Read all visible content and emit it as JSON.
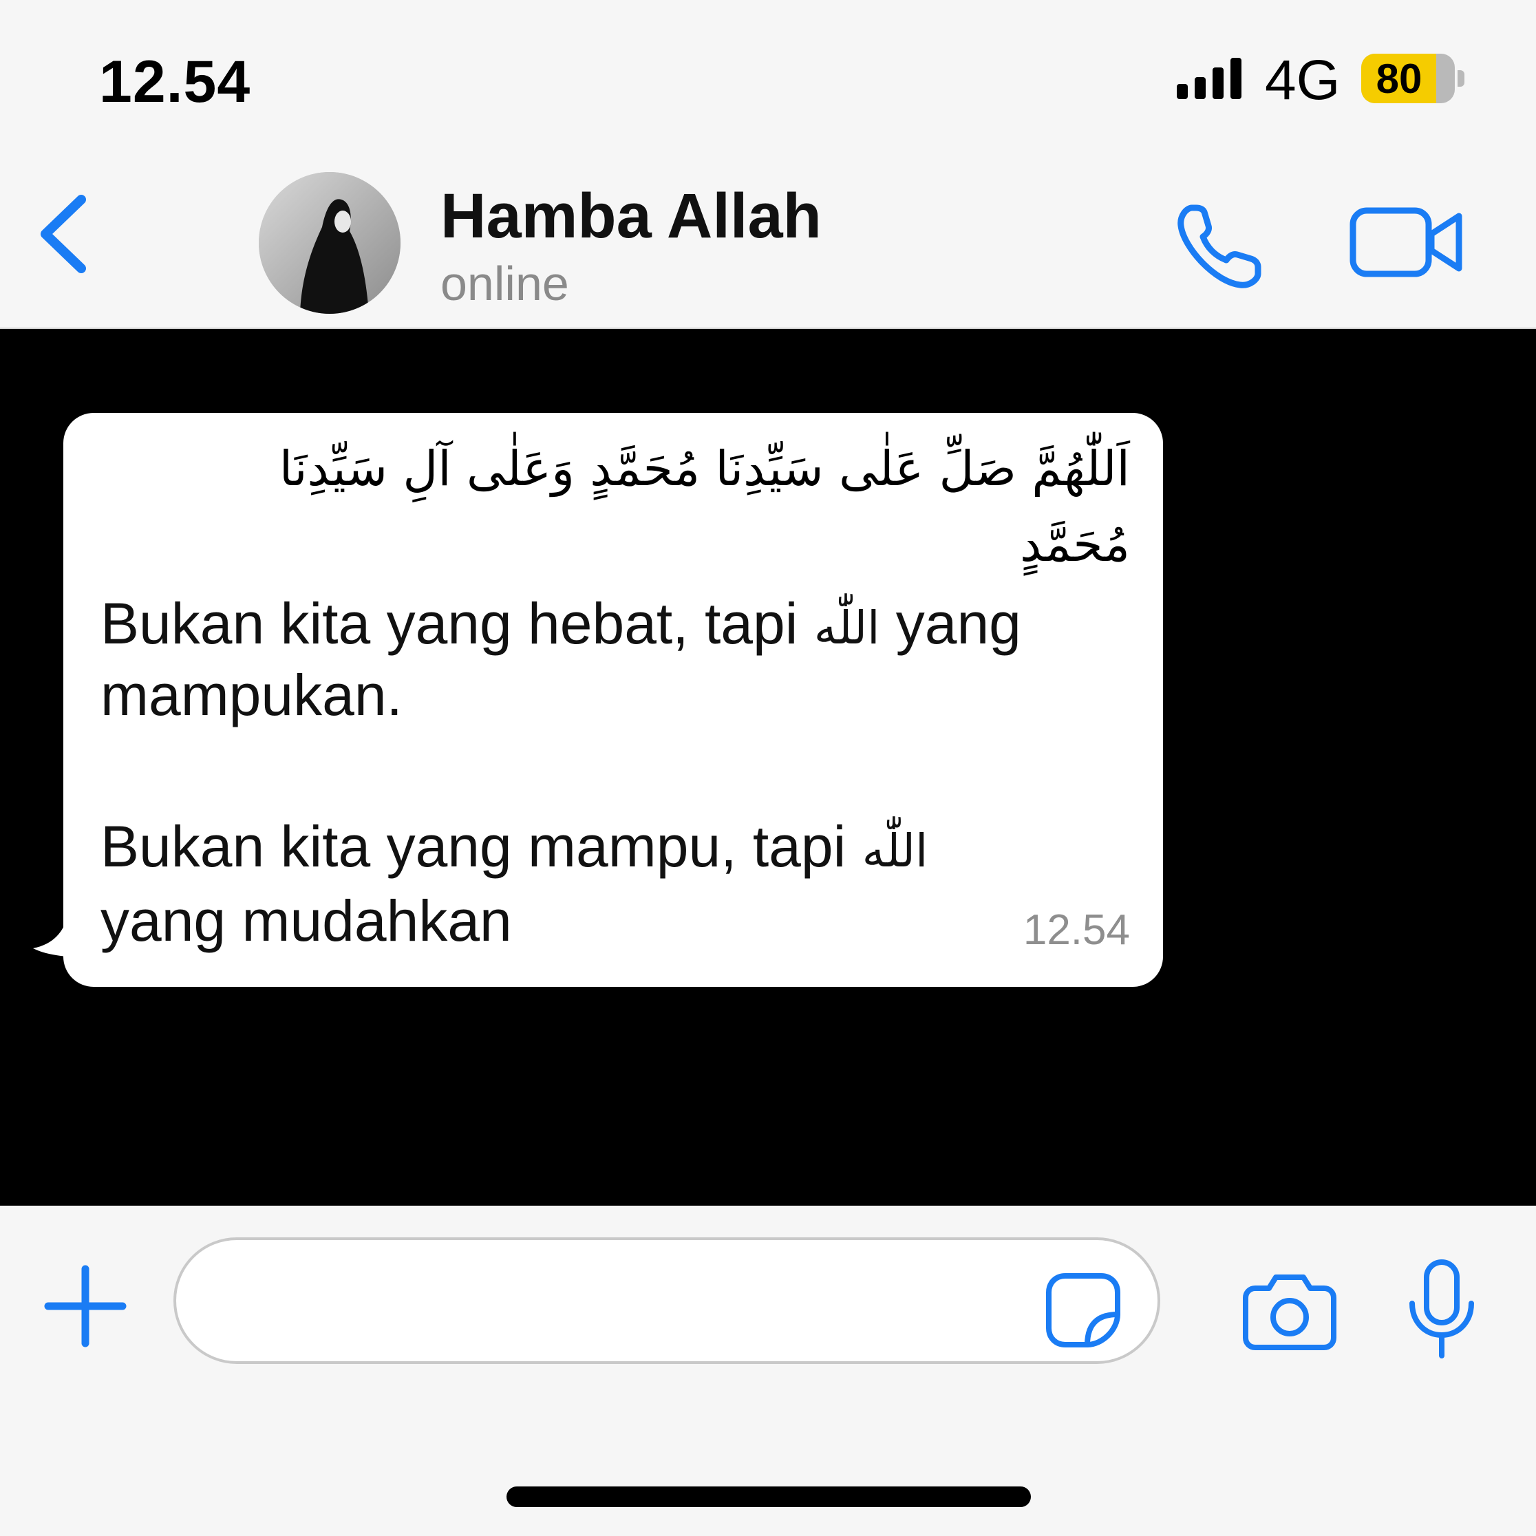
{
  "status_bar": {
    "time": "12.54",
    "network": "4G",
    "battery": "80"
  },
  "header": {
    "contact_name": "Hamba Allah",
    "contact_status": "online",
    "icons": [
      "back-icon",
      "avatar",
      "phone-icon",
      "video-icon"
    ]
  },
  "message": {
    "arabic_line1": "اَللّٰهُمَّ صَلِّ عَلٰى سَيِّدِنَا مُحَمَّدٍ وَعَلٰى آلِ سَيِّدِنَا",
    "arabic_line2": "مُحَمَّدٍ",
    "line1_before": "Bukan kita yang hebat, tapi ",
    "line1_allah": "اللّٰه",
    "line1_after": " yang",
    "line2": "mampukan.",
    "line3_before": "Bukan kita yang mampu, tapi ",
    "line3_allah": "اللّٰه",
    "line4": "yang mudahkan",
    "time": "12.54"
  },
  "input_bar": {
    "placeholder": "",
    "icons": [
      "plus-icon",
      "sticker-icon",
      "camera-icon",
      "microphone-icon"
    ]
  },
  "colors": {
    "accent": "#1a7cf4",
    "chat_background": "#000000",
    "bubble": "#ffffff",
    "bar_background": "#f6f6f6",
    "battery": "#f5cc00"
  }
}
